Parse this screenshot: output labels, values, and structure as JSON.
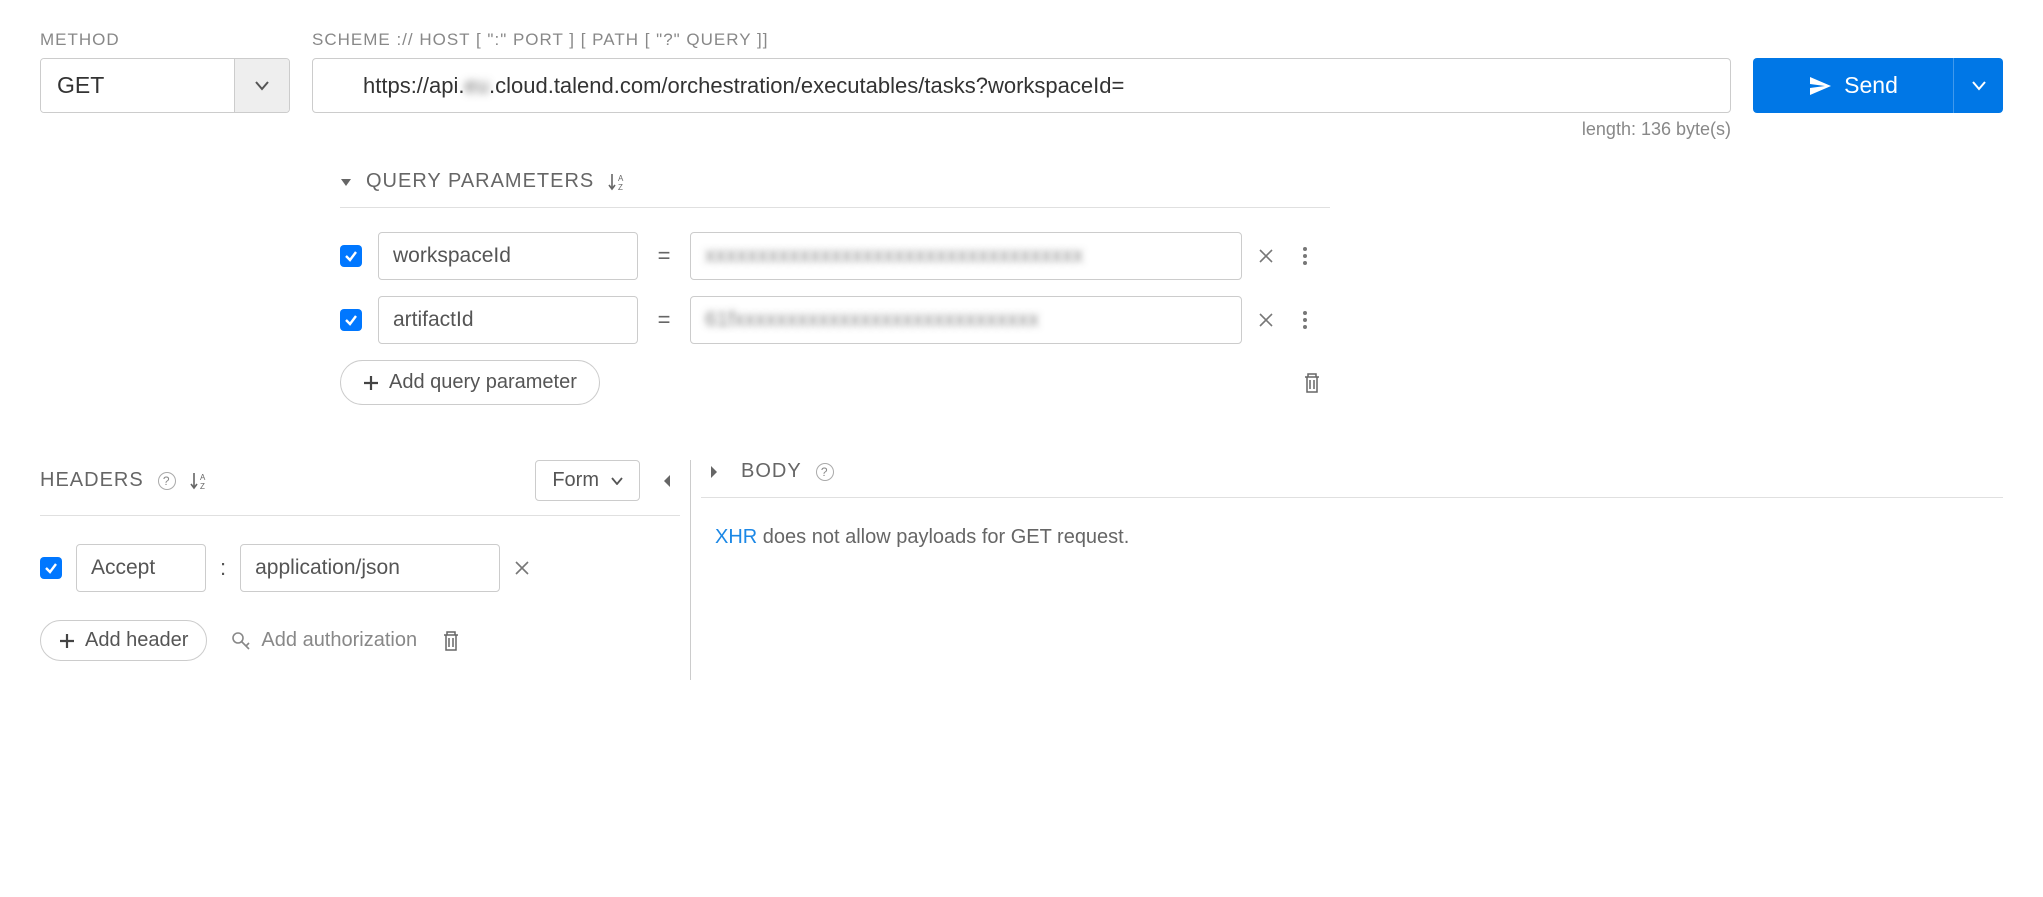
{
  "method": {
    "label": "METHOD",
    "value": "GET"
  },
  "url": {
    "label": "SCHEME :// HOST [ \":\" PORT ] [ PATH [ \"?\" QUERY ]]",
    "value_prefix": "https://api.",
    "value_blurred": "eu",
    "value_suffix": ".cloud.talend.com/orchestration/executables/tasks?workspaceId=",
    "length_text": "length: 136 byte(s)"
  },
  "send_button": {
    "label": "Send"
  },
  "query": {
    "title": "QUERY PARAMETERS",
    "add_label": "Add query parameter",
    "params": [
      {
        "enabled": true,
        "name": "workspaceId",
        "value_blurred": "xxxxxxxxxxxxxxxxxxxxxxxxxxxxxxxxxxxx"
      },
      {
        "enabled": true,
        "name": "artifactId",
        "value_blurred": "61fxxxxxxxxxxxxxxxxxxxxxxxxxxxxx"
      }
    ]
  },
  "headers": {
    "title": "HEADERS",
    "mode": "Form",
    "add_label": "Add header",
    "auth_label": "Add authorization",
    "rows": [
      {
        "enabled": true,
        "name": "Accept",
        "value": "application/json"
      }
    ]
  },
  "body": {
    "title": "BODY",
    "xhr_label": "XHR",
    "msg_rest": " does not allow payloads for GET request."
  }
}
